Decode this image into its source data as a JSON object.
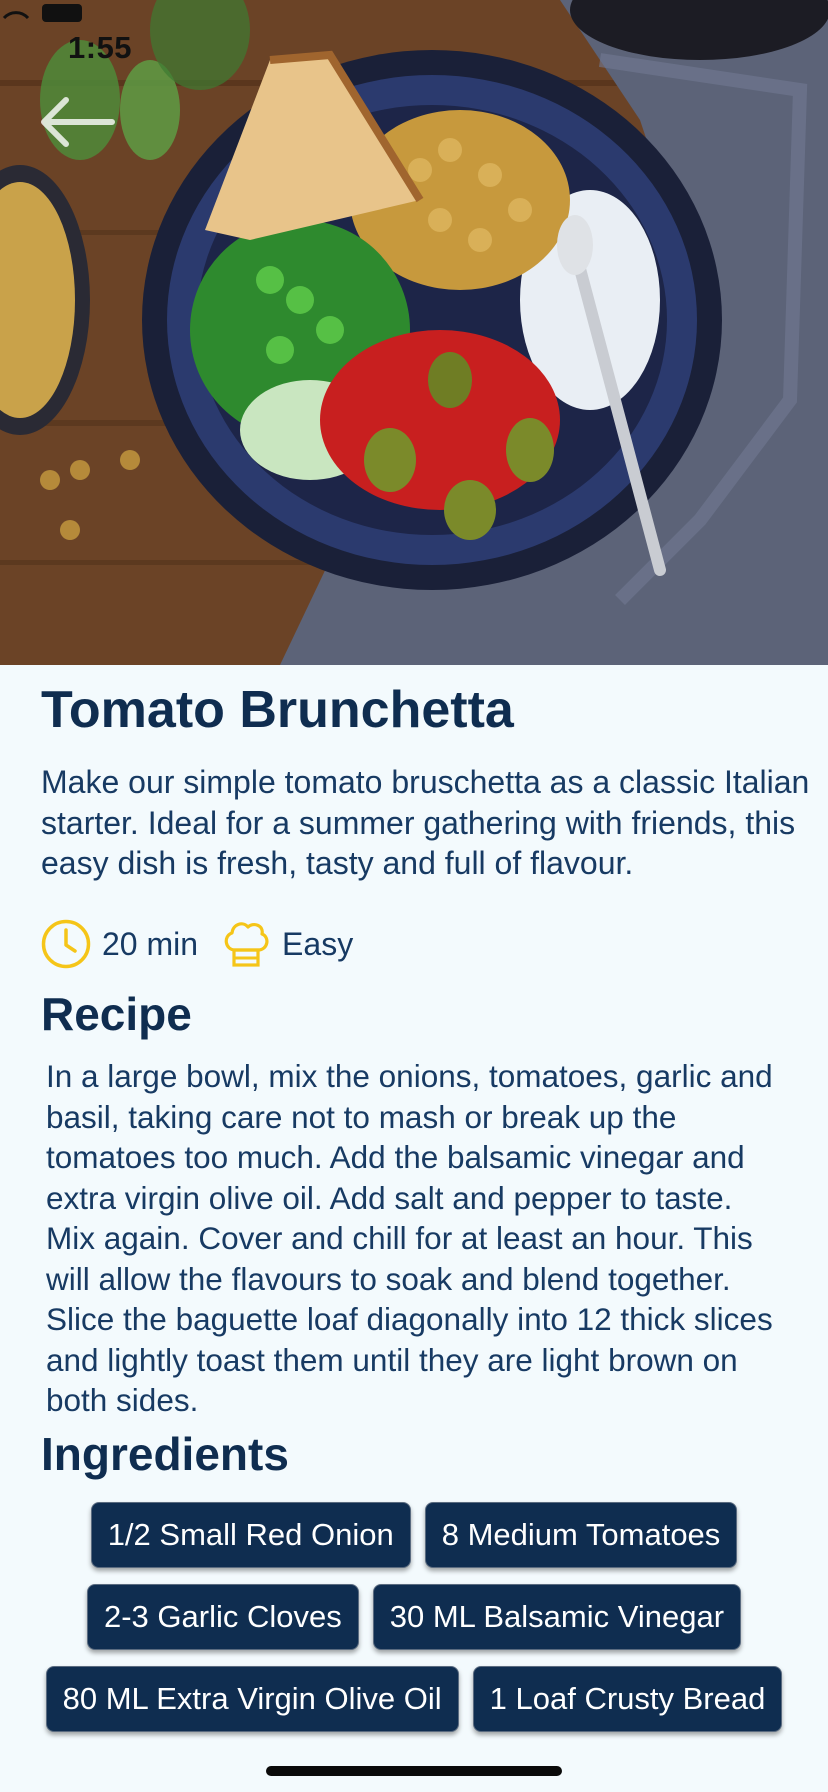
{
  "status_bar": {
    "time": "1:55"
  },
  "recipe": {
    "title": "Tomato Brunchetta",
    "description": "Make our simple tomato bruschetta as a classic Italian starter. Ideal for a summer gathering with friends, this easy dish is fresh, tasty and full of flavour.",
    "time": "20 min",
    "difficulty": "Easy",
    "recipe_heading": "Recipe",
    "instructions": "In a large bowl, mix the onions, tomatoes, garlic and basil, taking care not to mash or break up the tomatoes too much. Add the balsamic vinegar and extra virgin olive oil. Add salt and pepper to taste. Mix again. Cover and chill for at least an hour. This will allow the flavours to soak and blend together. Slice the baguette loaf diagonally into 12 thick slices and lightly toast them until they are light brown on both sides.",
    "ingredients_heading": "Ingredients",
    "ingredients": [
      "1/2 Small Red Onion",
      "8 Medium Tomatoes",
      "2-3 Garlic Cloves",
      "30 ML Balsamic Vinegar",
      "80 ML Extra Virgin Olive Oil",
      "1 Loaf Crusty Bread"
    ]
  },
  "icons": {
    "back": "arrow-left-icon",
    "time": "clock-icon",
    "difficulty": "chef-hat-icon"
  },
  "colors": {
    "primary": "#0f2d50",
    "accent": "#f5c518",
    "background": "#f3fafd"
  }
}
